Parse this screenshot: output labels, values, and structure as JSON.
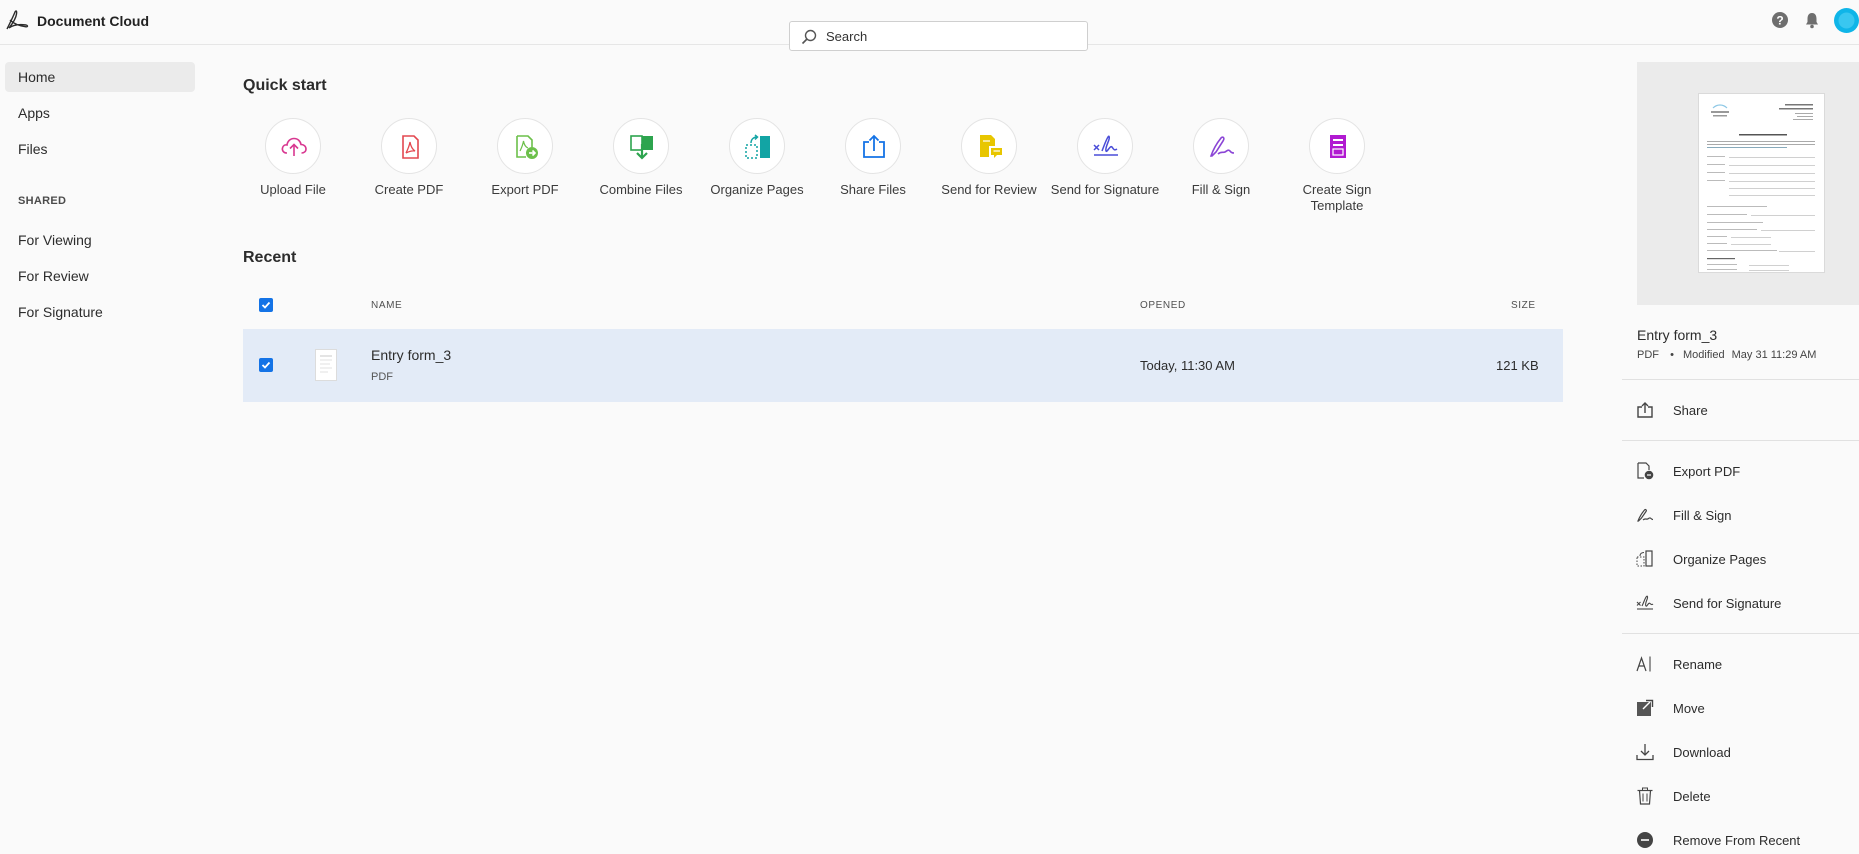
{
  "header": {
    "app_title": "Document Cloud",
    "search_placeholder": "Search",
    "icons": [
      "acrobat-logo-icon",
      "help-icon",
      "bell-icon",
      "avatar"
    ]
  },
  "nav": {
    "items": [
      {
        "label": "Home",
        "active": true
      },
      {
        "label": "Apps"
      },
      {
        "label": "Files"
      }
    ],
    "shared_heading": "SHARED",
    "shared_items": [
      {
        "label": "For Viewing"
      },
      {
        "label": "For Review"
      },
      {
        "label": "For Signature"
      }
    ]
  },
  "quick_start": {
    "title": "Quick start",
    "items": [
      {
        "label": "Upload File",
        "icon": "upload-cloud-icon",
        "color": "#d83790"
      },
      {
        "label": "Create PDF",
        "icon": "create-pdf-icon",
        "color": "#e34850"
      },
      {
        "label": "Export PDF",
        "icon": "export-pdf-icon",
        "color": "#6cc04a"
      },
      {
        "label": "Combine Files",
        "icon": "combine-files-icon",
        "color": "#2da44e"
      },
      {
        "label": "Organize Pages",
        "icon": "organize-pages-icon",
        "color": "#12a4a4"
      },
      {
        "label": "Share Files",
        "icon": "share-files-icon",
        "color": "#1473e6"
      },
      {
        "label": "Send for Review",
        "icon": "send-review-icon",
        "color": "#e8c600"
      },
      {
        "label": "Send for Signature",
        "icon": "send-signature-icon",
        "color": "#4a4dd8"
      },
      {
        "label": "Fill & Sign",
        "icon": "fill-sign-icon",
        "color": "#8b45d6"
      },
      {
        "label": "Create Sign Template",
        "icon": "sign-template-icon",
        "color": "#b11ad1"
      }
    ]
  },
  "recent": {
    "title": "Recent",
    "columns": {
      "name": "NAME",
      "opened": "OPENED",
      "size": "SIZE"
    },
    "rows": [
      {
        "name": "Entry form_3",
        "type": "PDF",
        "opened": "Today, 11:30 AM",
        "size": "121 KB",
        "selected": true
      }
    ]
  },
  "details": {
    "file_name": "Entry form_3",
    "file_type": "PDF",
    "separator": "•",
    "modified_label": "Modified",
    "modified_date": "May 31 11:29 AM",
    "actions": [
      {
        "label": "Share",
        "icon": "share-icon"
      },
      {
        "label": "Export PDF",
        "icon": "export-pdf-icon"
      },
      {
        "label": "Fill & Sign",
        "icon": "fill-sign-icon"
      },
      {
        "label": "Organize Pages",
        "icon": "organize-pages-icon"
      },
      {
        "label": "Send for Signature",
        "icon": "send-signature-icon"
      },
      {
        "label": "Rename",
        "icon": "rename-icon"
      },
      {
        "label": "Move",
        "icon": "move-icon"
      },
      {
        "label": "Download",
        "icon": "download-icon"
      },
      {
        "label": "Delete",
        "icon": "trash-icon"
      },
      {
        "label": "Remove From Recent",
        "icon": "remove-icon"
      }
    ]
  },
  "colors": {
    "accent": "#1473e6",
    "selected_row": "#e3ebf7",
    "avatar": "#0fb5e8"
  }
}
